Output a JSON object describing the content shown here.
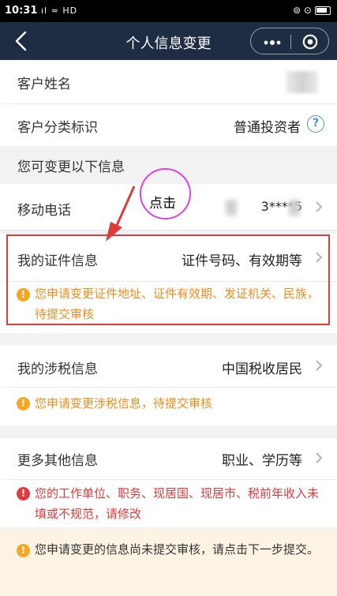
{
  "status_bar": {
    "time": "10:31",
    "left_icons": "ıl ≈ HD",
    "right_icons": "⊚ ⊙"
  },
  "nav": {
    "title": "个人信息变更"
  },
  "customer_name": {
    "label": "客户姓名"
  },
  "customer_type": {
    "label": "客户分类标识",
    "value": "普通投资者"
  },
  "section_head": "您可变更以下信息",
  "mobile": {
    "label": "移动电话",
    "value": "3****5"
  },
  "id_info": {
    "label": "我的证件信息",
    "value": "证件号码、有效期等",
    "notice": "您申请变更证件地址、证件有效期、发证机关、民族，待提交审核"
  },
  "tax_info": {
    "label": "我的涉税信息",
    "value": "中国税收居民",
    "notice": "您申请变更涉税信息，待提交审核"
  },
  "more_info": {
    "label": "更多其他信息",
    "value": "职业、学历等",
    "notice": "您的工作单位、职务、现居国、现居市、税前年收入未填或不规范，请修改"
  },
  "bottom_notice": "您申请变更的信息尚未提交审核，请点击下一步提交。",
  "annotation": {
    "click_label": "点击"
  },
  "colors": {
    "nav_bg": "#1f2d44",
    "warn_orange": "#f5a623",
    "warn_text": "#f08c1e",
    "error_red": "#e03b3b",
    "bottom_bg": "#fdf3e4"
  }
}
